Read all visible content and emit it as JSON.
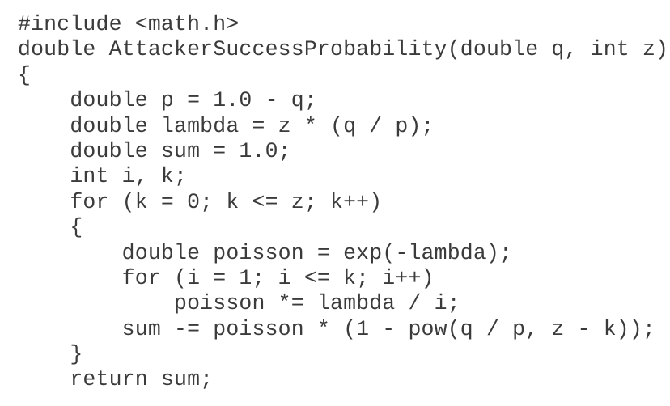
{
  "document": {
    "kind": "source-code-listing",
    "language": "C",
    "background_color": "#ffffff",
    "text_color": "#3b3b3b",
    "font_style": "monospace",
    "indent_unit_spaces": 4,
    "line_count": 15
  },
  "code": {
    "lines": [
      "#include <math.h>",
      "double AttackerSuccessProbability(double q, int z)",
      "{",
      "    double p = 1.0 - q;",
      "    double lambda = z * (q / p);",
      "    double sum = 1.0;",
      "    int i, k;",
      "    for (k = 0; k <= z; k++)",
      "    {",
      "        double poisson = exp(-lambda);",
      "        for (i = 1; i <= k; i++)",
      "            poisson *= lambda / i;",
      "        sum -= poisson * (1 - pow(q / p, z - k));",
      "    }",
      "    return sum;",
      "}"
    ]
  }
}
